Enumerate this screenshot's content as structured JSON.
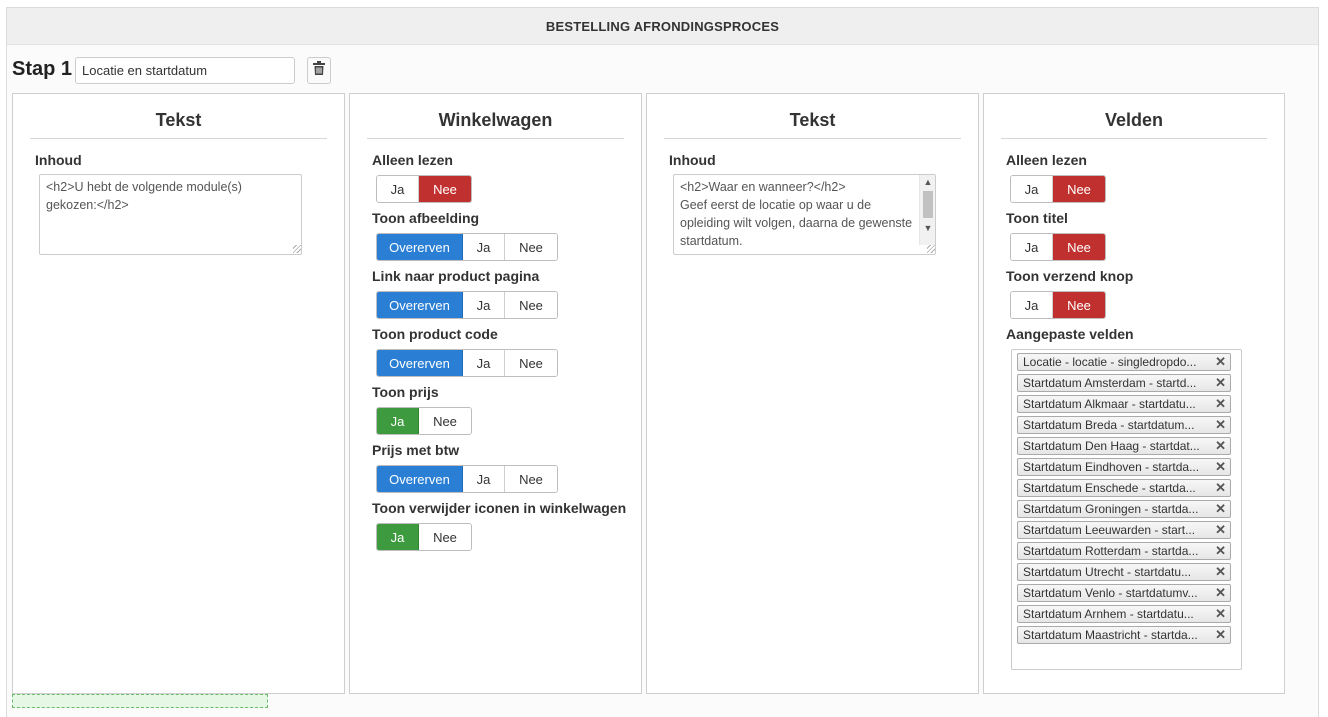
{
  "header": {
    "title": "BESTELLING AFRONDINGSPROCES"
  },
  "step": {
    "label": "Stap 1",
    "name_value": "Locatie en startdatum"
  },
  "icons": {
    "delete": "trash-icon",
    "tag_remove": "close-icon"
  },
  "colors": {
    "nee_active": "#c0302e",
    "overerven_active": "#2a7fd4",
    "ja_active": "#3e9a3e"
  },
  "toggle_labels": {
    "inherit": "Overerven",
    "yes": "Ja",
    "no": "Nee"
  },
  "panels": [
    {
      "title": "Tekst",
      "content_label": "Inhoud",
      "content_value": "<h2>U hebt de volgende module(s) gekozen:</h2>"
    },
    {
      "title": "Winkelwagen",
      "settings": [
        {
          "label": "Alleen lezen",
          "options": [
            "Ja",
            "Nee"
          ],
          "selected": "Nee"
        },
        {
          "label": "Toon afbeelding",
          "options": [
            "Overerven",
            "Ja",
            "Nee"
          ],
          "selected": "Overerven"
        },
        {
          "label": "Link naar product pagina",
          "options": [
            "Overerven",
            "Ja",
            "Nee"
          ],
          "selected": "Overerven"
        },
        {
          "label": "Toon product code",
          "options": [
            "Overerven",
            "Ja",
            "Nee"
          ],
          "selected": "Overerven"
        },
        {
          "label": "Toon prijs",
          "options": [
            "Ja",
            "Nee"
          ],
          "selected": "Ja"
        },
        {
          "label": "Prijs met btw",
          "options": [
            "Overerven",
            "Ja",
            "Nee"
          ],
          "selected": "Overerven"
        },
        {
          "label": "Toon verwijder iconen in winkelwagen",
          "options": [
            "Ja",
            "Nee"
          ],
          "selected": "Ja"
        }
      ]
    },
    {
      "title": "Tekst",
      "content_label": "Inhoud",
      "content_value": "<h2>Waar en wanneer?</h2>\nGeef eerst de locatie op waar u de opleiding wilt volgen, daarna de gewenste startdatum."
    },
    {
      "title": "Velden",
      "settings": [
        {
          "label": "Alleen lezen",
          "options": [
            "Ja",
            "Nee"
          ],
          "selected": "Nee"
        },
        {
          "label": "Toon titel",
          "options": [
            "Ja",
            "Nee"
          ],
          "selected": "Nee"
        },
        {
          "label": "Toon verzend knop",
          "options": [
            "Ja",
            "Nee"
          ],
          "selected": "Nee"
        }
      ],
      "custom_fields_label": "Aangepaste velden",
      "custom_fields": [
        "Locatie - locatie - singledropdo...",
        "Startdatum Amsterdam - startd...",
        "Startdatum Alkmaar - startdatu...",
        "Startdatum Breda - startdatum...",
        "Startdatum Den Haag - startdat...",
        "Startdatum Eindhoven - startda...",
        "Startdatum Enschede - startda...",
        "Startdatum Groningen - startda...",
        "Startdatum Leeuwarden - start...",
        "Startdatum Rotterdam - startda...",
        "Startdatum Utrecht - startdatu...",
        "Startdatum Venlo - startdatumv...",
        "Startdatum Arnhem - startdatu...",
        "Startdatum Maastricht - startda..."
      ]
    }
  ]
}
